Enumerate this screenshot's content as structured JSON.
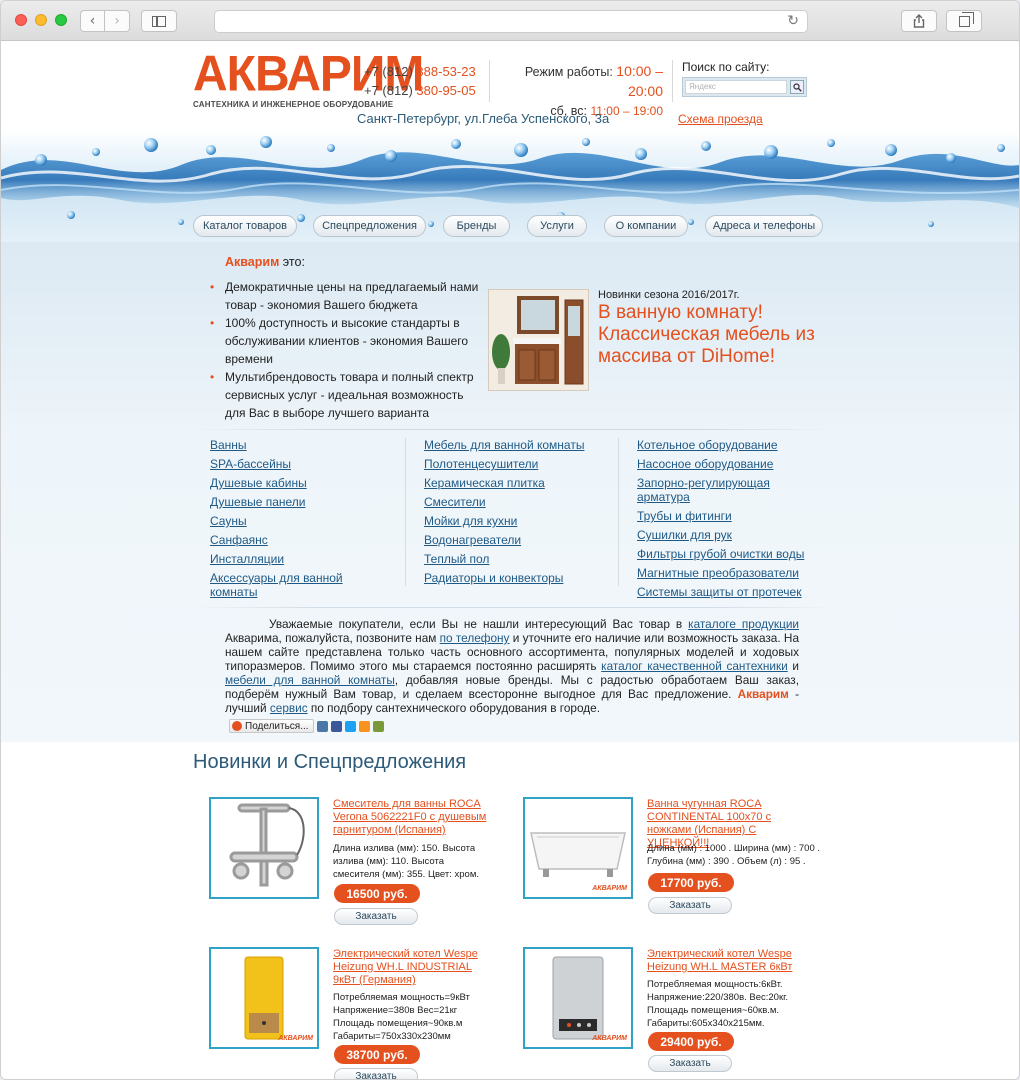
{
  "header": {
    "logo_title": "АКВАРИМ",
    "logo_subtitle": "САНТЕХНИКА И ИНЖЕНЕРНОЕ ОБОРУДОВАНИЕ",
    "phone_prefix_1": "+7 (812)",
    "phone_number_1": "388-53-23",
    "phone_prefix_2": "+7 (812)",
    "phone_number_2": "380-95-05",
    "hours_label": "Режим работы:",
    "hours_value": "10:00 – 20:00",
    "weekend_label": "сб, вс:",
    "weekend_value": "11:00 – 19:00",
    "search_label": "Поиск по сайту:",
    "search_placeholder": "Яндекс",
    "address": "Санкт-Петербург, ул.Глеба Успенского, 3а",
    "map_link": "Схема проезда"
  },
  "nav": [
    {
      "label": "Каталог товаров"
    },
    {
      "label": "Спецпредложения"
    },
    {
      "label": "Бренды"
    },
    {
      "label": "Услуги"
    },
    {
      "label": "О компании"
    },
    {
      "label": "Адреса и телефоны"
    }
  ],
  "intro": {
    "brand": "Акварим",
    "suffix": " это:",
    "benefits": [
      "Демократичные цены на предлагаемый нами товар - экономия Вашего бюджета",
      "100% доступность и высокие стандарты в обслуживании клиентов - экономия Вашего времени",
      "Мультибрендовость товара и полный спектр сервисных услуг - идеальная возможность для Вас в выборе лучшего варианта"
    ]
  },
  "promo": {
    "season": "Новинки сезона 2016/2017г.",
    "title": "В ванную комнату! Классическая мебель из массива от DiHome!"
  },
  "categories": {
    "col1": [
      "Ванны",
      "SPA-бассейны",
      "Душевые кабины",
      "Душевые панели",
      "Сауны",
      "Санфаянс",
      "Инсталляции",
      "Аксессуары для ванной комнаты"
    ],
    "col2": [
      "Мебель для ванной комнаты",
      "Полотенцесушители",
      "Керамическая плитка",
      "Смесители",
      "Мойки для кухни",
      "Водонагреватели",
      "Теплый пол",
      "Радиаторы и конвекторы"
    ],
    "col3": [
      "Котельное оборудование",
      "Насосное оборудование",
      "Запорно-регулирующая арматура",
      "Трубы и фитинги",
      "Сушилки для рук",
      "Фильтры грубой очистки воды",
      "Магнитные преобразователи",
      "Системы защиты от протечек"
    ]
  },
  "para": {
    "t1": "Уважаемые покупатели, если Вы не нашли интересующий Вас товар в ",
    "l1": "каталоге продукции",
    "t2": " Акварима, пожалуйста, позвоните нам ",
    "l2": "по телефону",
    "t3": " и уточните его наличие или возможность заказа. На нашем сайте представлена только часть основного ассортимента, популярных моделей и ходовых типоразмеров. Помимо этого мы стараемся постоянно расширять ",
    "l3": "каталог качественной сантехники",
    "t4": " и ",
    "l4": "мебели для ванной комнаты",
    "t5": ", добавляя новые бренды. Мы с радостью обработаем Ваш заказ, подберём нужный Вам товар, и сделаем всесторонне выгодное для Вас предложение. ",
    "brand": "Акварим",
    "t6": " - лучший ",
    "l5": "сервис",
    "t7": " по подбору сантехнического оборудования в городе."
  },
  "share_label": "Поделиться...",
  "section_title": "Новинки и Спецпредложения",
  "watermark": "АКВАРИМ",
  "products": [
    {
      "name": "Смеситель для ванны ROCA Verona 5062221F0 с душевым гарнитуром (Испания)",
      "desc": "Длина излива (мм): 150. Высота излива (мм): 110. Высота смесителя (мм): 355. Цвет: хром.",
      "price": "16500 руб.",
      "order": "Заказать"
    },
    {
      "name": "Ванна чугунная ROCA CONTINENTAL 100х70 с ножками (Испания) С УЦЕНКОЙ!!!",
      "desc": "Длина (мм) : 1000 . Ширина (мм) : 700 . Глубина (мм) : 390 . Объем (л) : 95 .",
      "price": "17700 руб.",
      "order": "Заказать"
    },
    {
      "name": "Электрический котел Wespe Heizung WH.L INDUSTRIAL 9кВт (Германия)",
      "desc": "Потребляемая мощность=9кВт Напряжение=380в Вес=21кг Площадь помещения~90кв.м Габариты=750х330х230мм",
      "price": "38700 руб.",
      "order": "Заказать"
    },
    {
      "name": "Электрический котел Wespe Heizung WH.L MASTER 6кВт",
      "desc": "Потребляемая мощность:6кВт. Напряжение:220/380в. Вес:20кг. Площадь помещения~60кв.м. Габариты:605х340х215мм.",
      "price": "29400 руб.",
      "order": "Заказать"
    }
  ]
}
